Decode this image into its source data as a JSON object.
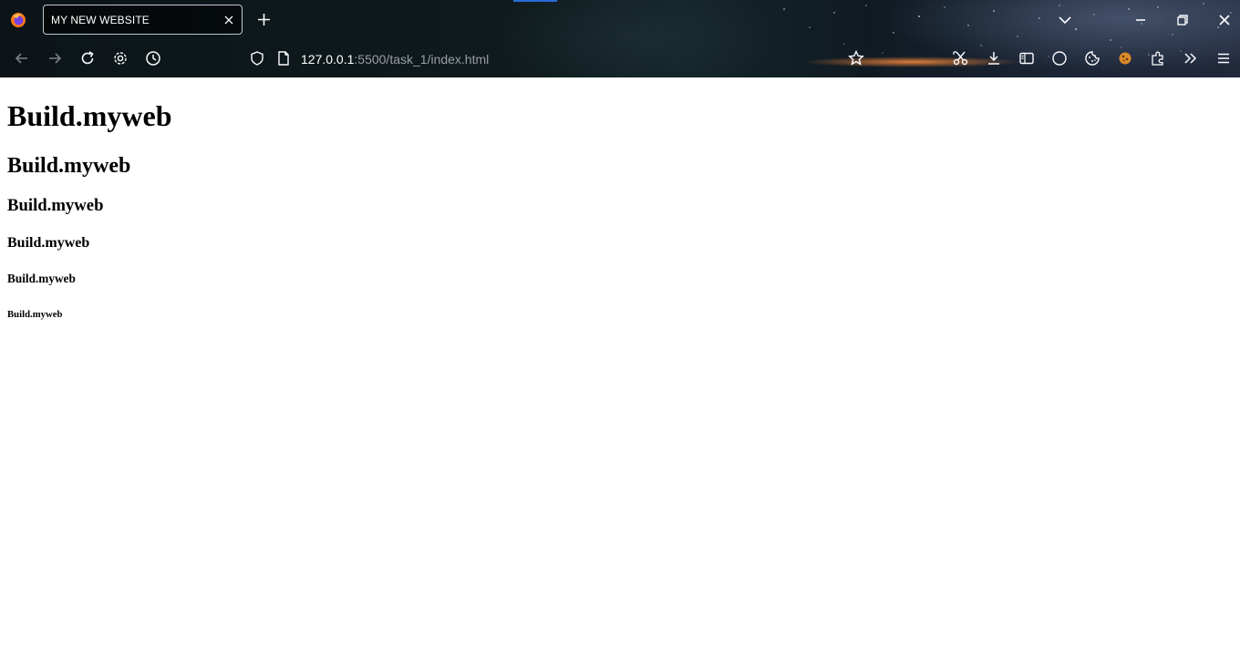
{
  "browser": {
    "tab_title": "MY NEW WEBSITE",
    "url_host": "127.0.0.1",
    "url_rest": ":5500/task_1/index.html"
  },
  "page": {
    "h1": "Build.myweb",
    "h2": "Build.myweb",
    "h3": "Build.myweb",
    "h4": "Build.myweb",
    "h5": "Build.myweb",
    "h6": "Build.myweb"
  },
  "icons": {
    "browser_logo": "firefox-icon",
    "tab_close": "close-icon",
    "new_tab": "plus-icon",
    "list_tabs": "chevron-down-icon",
    "minimize": "minimize-icon",
    "restore": "restore-icon",
    "close_window": "close-icon",
    "back": "back-arrow-icon",
    "forward": "forward-arrow-icon",
    "reload": "reload-icon",
    "settings": "gear-icon",
    "history": "clock-icon",
    "tracking_protection": "shield-icon",
    "page_info": "page-icon",
    "bookmark": "star-icon",
    "screenshot": "scissors-icon",
    "downloads": "download-icon",
    "sidebar": "sidebar-icon",
    "account": "circle-icon",
    "cookies": "cookie-icon",
    "cookies_ext": "cookie-extension-icon",
    "extensions": "puzzle-icon",
    "overflow": "double-chevron-icon",
    "menu": "hamburger-menu-icon"
  },
  "colors": {
    "chrome_text": "#fbfbfe",
    "url_dim": "#9a9ea8",
    "tab_border": "#b9c8d6",
    "page_bg": "#ffffff",
    "heading_text": "#000000"
  }
}
